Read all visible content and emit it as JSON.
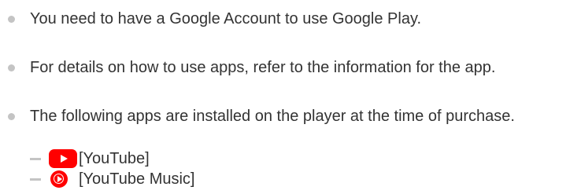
{
  "bullets": [
    {
      "text": "You need to have a Google Account to use Google Play."
    },
    {
      "text": "For details on how to use apps, refer to the information for the app."
    },
    {
      "text": "The following apps are installed on the player at the time of purchase."
    }
  ],
  "apps": [
    {
      "label": "[YouTube]",
      "icon": "youtube-icon"
    },
    {
      "label": "[YouTube Music]",
      "icon": "youtube-music-icon"
    }
  ],
  "colors": {
    "text": "#333333",
    "bullet": "#c4c4c4",
    "brand_red": "#ff0000"
  }
}
